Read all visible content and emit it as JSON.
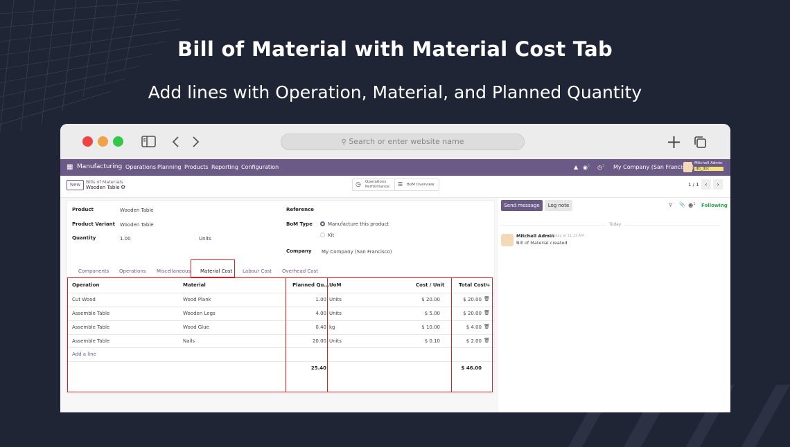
{
  "hero": {
    "title": "Bill of Material with Material Cost Tab",
    "subtitle": "Add lines with Operation, Material, and Planned Quantity"
  },
  "browser": {
    "address_placeholder": "Search or enter website name",
    "colors": {
      "red": "#ee4444",
      "yellow": "#f0a24a",
      "green": "#34c84a"
    }
  },
  "appbar": {
    "app_name": "Manufacturing",
    "menu": [
      "Operations",
      "Planning",
      "Products",
      "Reporting",
      "Configuration"
    ],
    "company": "My Company (San Francisco)",
    "user": "Mitchell Admin",
    "db": "db_doc",
    "badge_chat": "5",
    "badge_activity": "3",
    "accent": "#6b5a86"
  },
  "control_panel": {
    "new_label": "New",
    "breadcrumb_parent": "Bills of Materials",
    "breadcrumb_current": "Wooden Table",
    "ops_perf_line1": "Operations",
    "ops_perf_line2": "Performance",
    "bom_overview": "BoM Overview",
    "pager": "1 / 1"
  },
  "form": {
    "product_label": "Product",
    "product_value": "Wooden Table",
    "variant_label": "Product Variant",
    "variant_value": "Wooden Table",
    "quantity_label": "Quantity",
    "quantity_value": "1.00",
    "quantity_uom": "Units",
    "reference_label": "Reference",
    "bom_type_label": "BoM Type",
    "bom_type_opt1": "Manufacture this product",
    "bom_type_opt2": "Kit",
    "company_label": "Company",
    "company_value": "My Company (San Francisco)"
  },
  "tabs": [
    "Components",
    "Operations",
    "Miscellaneous",
    "Material Cost",
    "Labour Cost",
    "Overhead Cost"
  ],
  "table": {
    "headers": {
      "operation": "Operation",
      "material": "Material",
      "planned": "Planned Qu...",
      "uom": "UoM",
      "cost_unit": "Cost / Unit",
      "total": "Total Cost"
    },
    "rows": [
      {
        "operation": "Cut Wood",
        "material": "Wood Plank",
        "planned": "1.00",
        "uom": "Units",
        "cost_unit": "$ 20.00",
        "total": "$ 20.00"
      },
      {
        "operation": "Assemble Table",
        "material": "Wooden Legs",
        "planned": "4.00",
        "uom": "Units",
        "cost_unit": "$ 5.00",
        "total": "$ 20.00"
      },
      {
        "operation": "Assemble Table",
        "material": "Wood Glue",
        "planned": "0.40",
        "uom": "kg",
        "cost_unit": "$ 10.00",
        "total": "$ 4.00"
      },
      {
        "operation": "Assemble Table",
        "material": "Nails",
        "planned": "20.00",
        "uom": "Units",
        "cost_unit": "$ 0.10",
        "total": "$ 2.00"
      }
    ],
    "add_line": "Add a line",
    "sum_planned": "25.40",
    "sum_total": "$ 46.00"
  },
  "chatter": {
    "send_message": "Send message",
    "log_note": "Log note",
    "followers_count": "1",
    "following": "Following",
    "day": "Today",
    "author": "Mitchell Admin",
    "time": "Today at 11:13 AM",
    "message": "Bill of Material created"
  }
}
